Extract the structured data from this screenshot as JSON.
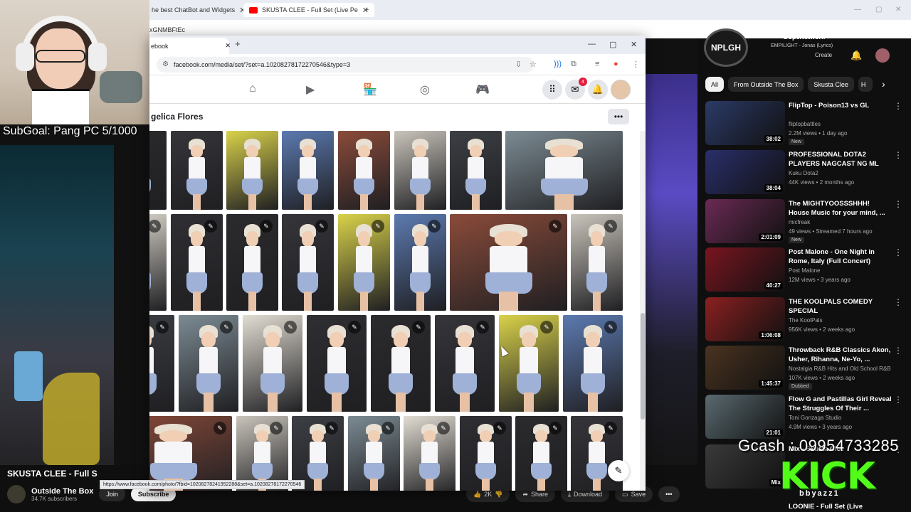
{
  "bg_browser": {
    "tabs": [
      {
        "label": "he best ChatBot and Widgets"
      },
      {
        "label": "SKUSTA CLEE - Full Set (Live Pe"
      }
    ],
    "address_fragment": "xGNMBFtEc"
  },
  "overlay": {
    "subgoal": "SubGoal: Pang PC 5/1000",
    "gcash": "Gcash : 09954733285",
    "kick": "KICK",
    "kick_handle": "bbyazz1"
  },
  "video": {
    "title": "SKUSTA CLEE - Full S",
    "channel": "Outside The Box",
    "subscribers": "34.7K subscribers",
    "join": "Join",
    "subscribe": "Subscribe",
    "likes": "2K",
    "share": "Share",
    "download": "Download",
    "save": "Save"
  },
  "now_playing": {
    "logo": "NPLGH",
    "title": "DopeNetwork",
    "subtitle": "EMPILIGHT - Jonas (Lyrics)",
    "create": "Create"
  },
  "chips": [
    "All",
    "From Outside The Box",
    "Skusta Clee",
    "H"
  ],
  "recommendations": [
    {
      "title": "FlipTop - Poison13 vs GL",
      "channel": "fliptopbattles",
      "meta": "2.2M views • 1 day ago",
      "badge": "New",
      "duration": "38:02",
      "color": "#2b3a67"
    },
    {
      "title": "PROFESSIONAL DOTA2 PLAYERS NAGCAST NG ML",
      "channel": "Kuku Dota2",
      "meta": "44K views • 2 months ago",
      "badge": "",
      "duration": "38:04",
      "color": "#2a2f6b"
    },
    {
      "title": "The MIGHTYOOSSSHHH! House Music for your mind, ...",
      "channel": "micfreak",
      "meta": "49 views • Streamed 7 hours ago",
      "badge": "New",
      "duration": "2:01:09",
      "color": "#6b2a55"
    },
    {
      "title": "Post Malone - One Night in Rome, Italy (Full Concert)",
      "channel": "Post Malone",
      "meta": "12M views • 3 years ago",
      "badge": "",
      "duration": "40:27",
      "color": "#7a1520"
    },
    {
      "title": "THE KOOLPALS COMEDY SPECIAL",
      "channel": "The KoolPals",
      "meta": "956K views • 2 weeks ago",
      "badge": "",
      "duration": "1:06:08",
      "color": "#8c2020"
    },
    {
      "title": "Throwback R&B Classics Akon, Usher, Rihanna, Ne-Yo, ...",
      "channel": "Nostalgia R&B Hits and Old School R&B",
      "meta": "107K views • 2 weeks ago",
      "badge": "Dubbed",
      "duration": "1:45:37",
      "color": "#4a3320"
    },
    {
      "title": "Flow G and Pastillas Girl Reveal The Struggles Of Their ...",
      "channel": "Toni Gonzaga Studio",
      "meta": "4.9M views • 3 years ago",
      "badge": "",
      "duration": "21:01",
      "color": "#5a6a70"
    },
    {
      "title": "Mix - Skusta Clee",
      "channel": "",
      "meta": "",
      "badge": "",
      "duration": "Mix",
      "color": "#3a3a3a"
    }
  ],
  "last_rec_title": "LOONIE - Full Set (Live",
  "fb": {
    "tab_label": "ebook",
    "url": "facebook.com/media/set/?set=a.10208278172270546&type=3",
    "notif_count": "4",
    "album_owner": "gelica Flores",
    "status_url": "https://www.facebook.com/photo/?fbid=10208278241952288&set=a.10208278172270546"
  }
}
